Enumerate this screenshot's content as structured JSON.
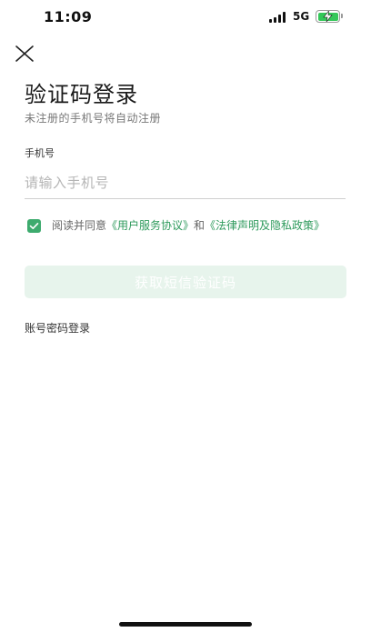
{
  "status_bar": {
    "time": "11:09",
    "network": "5G",
    "battery_level": 1.0,
    "battery_color": "#34c759"
  },
  "header": {
    "close_icon": "close-icon",
    "title": "验证码登录",
    "subtitle": "未注册的手机号将自动注册"
  },
  "form": {
    "phone_label": "手机号",
    "phone_placeholder": "请输入手机号",
    "phone_value": "",
    "agreement": {
      "checked": true,
      "prefix": "阅读并同意",
      "user_agreement": "《用户服务协议》",
      "conjunction": "和",
      "legal_policy": "《法律声明及隐私政策》"
    },
    "submit_label": "获取短信验证码",
    "alt_login": "账号密码登录"
  },
  "colors": {
    "accent": "#2e9a5c",
    "checkbox": "#3dab6e",
    "button_disabled_bg": "#e7f4ec"
  }
}
